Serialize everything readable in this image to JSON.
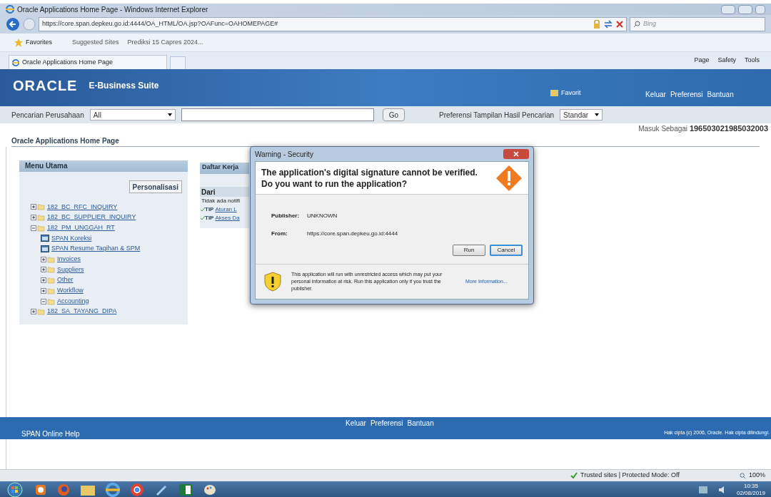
{
  "window": {
    "title": "Oracle Applications Home Page - Windows Internet Explorer"
  },
  "address_bar": {
    "url": "https://core.span.depkeu.go.id:4444/OA_HTML/OA.jsp?OAFunc=OAHOMEPAGE#",
    "search_placeholder": "Bing"
  },
  "favorites_bar": {
    "favorites": "Favorites",
    "links": [
      "Suggested Sites",
      "Prediksi 15 Capres 2024..."
    ]
  },
  "tab": {
    "title": "Oracle Applications Home Page"
  },
  "command_bar": [
    "Page",
    "Safety",
    "Tools"
  ],
  "header": {
    "logo": "ORACLE",
    "suite": "E-Business Suite",
    "favorites": "Favorit",
    "links": [
      "Keluar",
      "Preferensi",
      "Bantuan"
    ]
  },
  "search": {
    "label": "Pencarian Perusahaan",
    "scope": "All",
    "button": "Go",
    "pref_label": "Preferensi Tampilan Hasil Pencarian",
    "pref_value": "Standar"
  },
  "login": {
    "label": "Masuk Sebagai",
    "user": "196503021985032003"
  },
  "page_title": "Oracle Applications Home Page",
  "menu": {
    "title": "Menu Utama",
    "button": "Personalisasi",
    "items": [
      {
        "kind": "folder",
        "label": "182_BC_RFC_INQUIRY",
        "expanded": false
      },
      {
        "kind": "folder",
        "label": "182_BC_SUPPLIER_INQUIRY",
        "expanded": false
      },
      {
        "kind": "folder",
        "label": "182_PM_UNGGAH_RT",
        "expanded": true,
        "children": [
          {
            "kind": "function",
            "label": "SPAN Koreksi"
          },
          {
            "kind": "function",
            "label": "SPAN Resume Tagihan & SPM"
          },
          {
            "kind": "folder",
            "label": "Invoices",
            "expanded": false
          },
          {
            "kind": "folder",
            "label": "Suppliers",
            "expanded": false
          },
          {
            "kind": "folder",
            "label": "Other",
            "expanded": false
          },
          {
            "kind": "folder",
            "label": "Workflow",
            "expanded": false
          },
          {
            "kind": "folder",
            "label": "Accounting",
            "expanded": true
          }
        ]
      },
      {
        "kind": "folder",
        "label": "182_SA_TAYANG_DIPA",
        "expanded": false
      }
    ]
  },
  "worklist": {
    "title": "Daftar Kerja",
    "column": "Dari",
    "empty": "Tidak ada notifi",
    "tips": [
      {
        "tag": "TIP",
        "link": "Aturan L"
      },
      {
        "tag": "TIP",
        "link": "Akses Da"
      }
    ]
  },
  "dialog": {
    "title": "Warning - Security",
    "heading": "The application's digital signature cannot be verified.\nDo you want to run the application?",
    "fields": [
      {
        "label": "Publisher:",
        "value": "UNKNOWN"
      },
      {
        "label": "From:",
        "value": "https://core.span.depkeu.go.id:4444"
      }
    ],
    "buttons": [
      {
        "label": "Run",
        "selected": false
      },
      {
        "label": "Cancel",
        "selected": true
      }
    ],
    "warning": "This application will run with unrestricted access which may put your personal information at risk. Run this application only if you trust the publisher.",
    "more": "More Information..."
  },
  "footer": {
    "links": [
      "Keluar",
      "Preferensi",
      "Bantuan"
    ],
    "help": "SPAN Online Help",
    "copyright": "Hak cipta (c) 2006, Oracle. Hak cipta dilindungi."
  },
  "status_bar": {
    "zone": "Trusted sites | Protected Mode: Off",
    "zoom": "100%"
  },
  "taskbar": {
    "time": "10:35",
    "date": "02/08/2019"
  }
}
